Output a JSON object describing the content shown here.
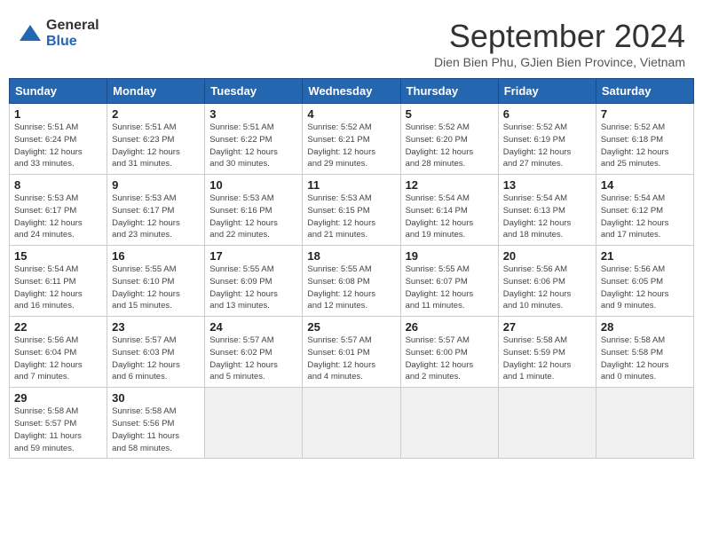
{
  "header": {
    "logo": {
      "general": "General",
      "blue": "Blue"
    },
    "title": "September 2024",
    "subtitle": "Dien Bien Phu, GJien Bien Province, Vietnam"
  },
  "calendar": {
    "days_of_week": [
      "Sunday",
      "Monday",
      "Tuesday",
      "Wednesday",
      "Thursday",
      "Friday",
      "Saturday"
    ],
    "weeks": [
      [
        null,
        null,
        null,
        null,
        null,
        null,
        null
      ]
    ],
    "cells": [
      {
        "day": null
      },
      {
        "day": null
      },
      {
        "day": null
      },
      {
        "day": null
      },
      {
        "day": null
      },
      {
        "day": null
      },
      {
        "day": null
      }
    ]
  }
}
